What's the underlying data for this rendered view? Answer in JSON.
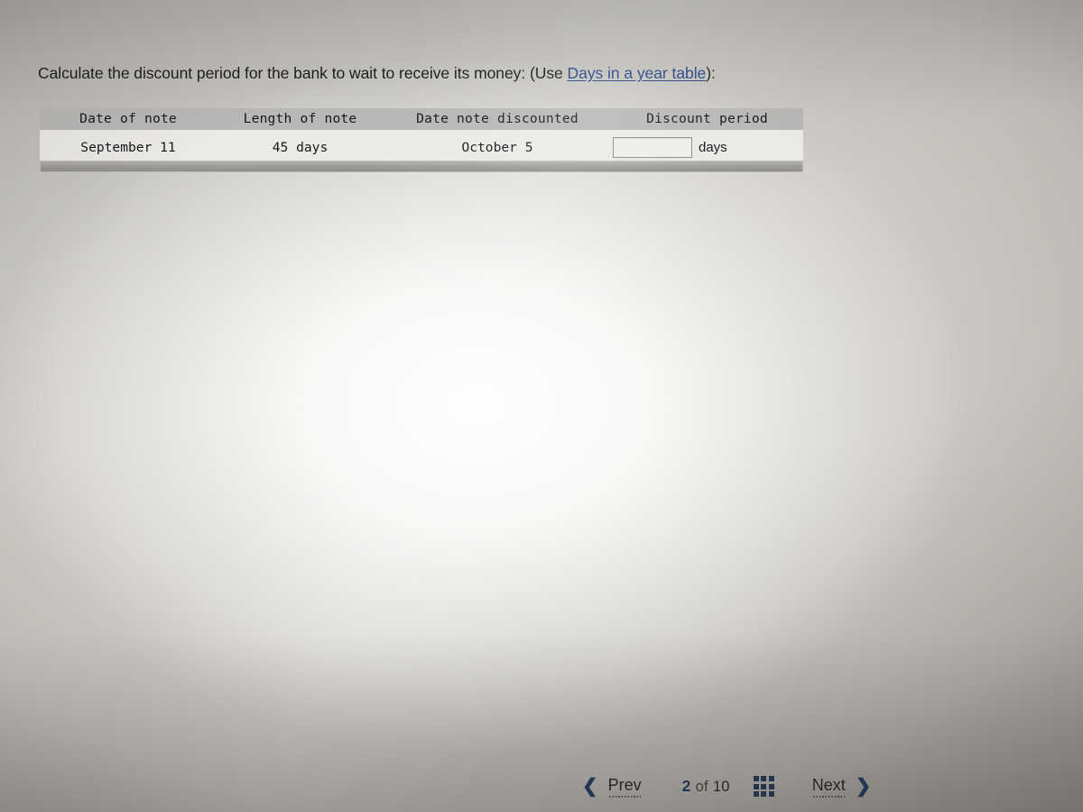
{
  "question": {
    "text_before_link": "Calculate the discount period for the bank to wait to receive its money: (Use ",
    "link_label": "Days in a year table",
    "text_after_link": "):"
  },
  "table": {
    "headers": [
      "Date of note",
      "Length of note",
      "Date note discounted",
      "Discount period"
    ],
    "rows": [
      {
        "date_of_note": "September 11",
        "length_of_note": "45 days",
        "date_note_discounted": "October 5",
        "discount_period_value": "",
        "discount_period_placeholder": "",
        "discount_period_unit": "days"
      }
    ]
  },
  "bottom_nav": {
    "prev_label": "Prev",
    "prev_icon": "chevron-left-icon",
    "next_label": "Next",
    "next_icon": "chevron-right-icon",
    "grid_icon": "grid-menu-icon",
    "current_page": "2",
    "page_separator": "of",
    "total_pages": "10"
  },
  "colors": {
    "link": "#1d3f86",
    "accent_navy": "#16325c",
    "grid_icon": "#1b2f54",
    "table_header_bg": "#b9b8b6",
    "table_row_bg": "#eceae6"
  }
}
